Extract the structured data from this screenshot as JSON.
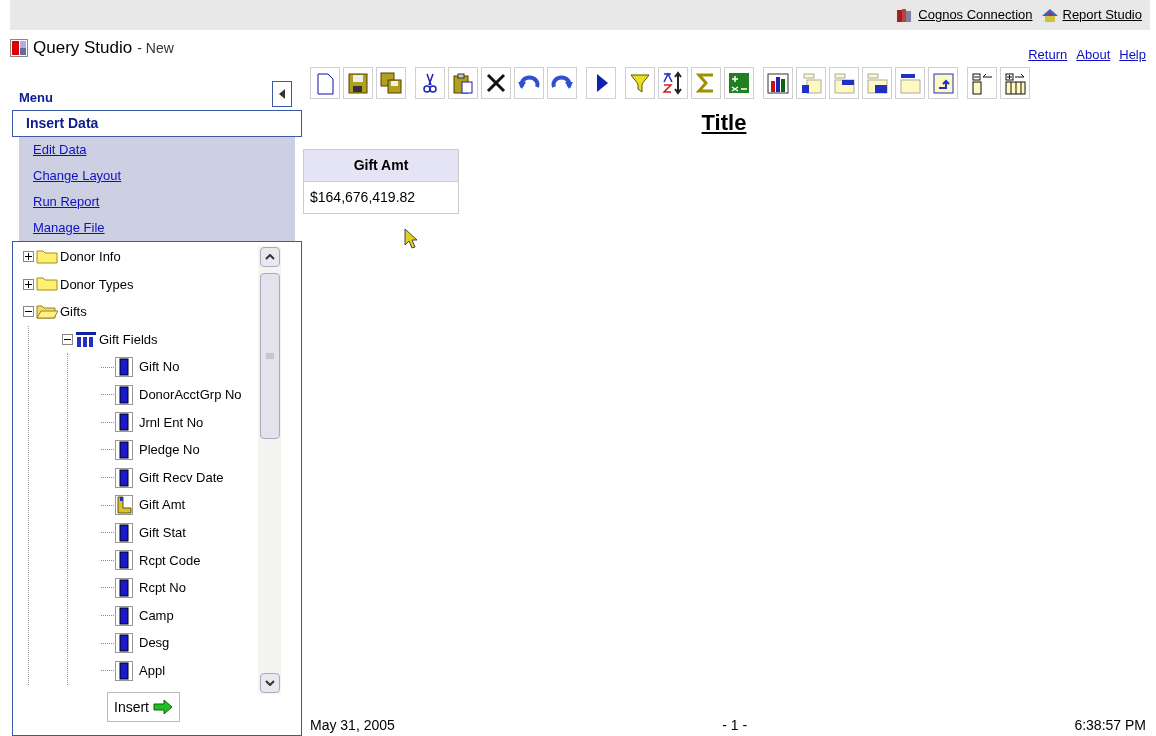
{
  "top_links": [
    {
      "kind": "connection",
      "label": "Cognos Connection"
    },
    {
      "kind": "studio",
      "label": "Report Studio"
    }
  ],
  "app": {
    "title": "Query Studio",
    "subtitle": "- New"
  },
  "header_links": [
    "Return",
    "About",
    "Help"
  ],
  "menu": {
    "title": "Menu",
    "items": [
      {
        "label": "Insert Data",
        "selected": true
      },
      {
        "label": "Edit Data",
        "selected": false
      },
      {
        "label": "Change Layout",
        "selected": false
      },
      {
        "label": "Run Report",
        "selected": false
      },
      {
        "label": "Manage File",
        "selected": false
      }
    ]
  },
  "tree": [
    {
      "label": "Donor Info",
      "kind": "folder",
      "expanded": false
    },
    {
      "label": "Donor Types",
      "kind": "folder",
      "expanded": false
    },
    {
      "label": "Gifts",
      "kind": "folder",
      "expanded": true,
      "children": [
        {
          "label": "Gift Fields",
          "kind": "table",
          "expanded": true,
          "children": [
            {
              "label": "Gift No",
              "kind": "attribute"
            },
            {
              "label": "DonorAcctGrp No",
              "kind": "attribute"
            },
            {
              "label": "Jrnl Ent No",
              "kind": "attribute"
            },
            {
              "label": "Pledge No",
              "kind": "attribute"
            },
            {
              "label": "Gift Recv Date",
              "kind": "attribute"
            },
            {
              "label": "Gift Amt",
              "kind": "measure"
            },
            {
              "label": "Gift Stat",
              "kind": "attribute"
            },
            {
              "label": "Rcpt Code",
              "kind": "attribute"
            },
            {
              "label": "Rcpt No",
              "kind": "attribute"
            },
            {
              "label": "Camp",
              "kind": "attribute"
            },
            {
              "label": "Desg",
              "kind": "attribute"
            },
            {
              "label": "Appl",
              "kind": "attribute"
            }
          ]
        }
      ]
    }
  ],
  "insert_button": "Insert",
  "toolbar": [
    {
      "tools": [
        {
          "kind": "new"
        },
        {
          "kind": "save"
        },
        {
          "kind": "save_as"
        }
      ]
    },
    {
      "tools": [
        {
          "kind": "cut"
        },
        {
          "kind": "paste"
        },
        {
          "kind": "delete"
        },
        {
          "kind": "undo"
        },
        {
          "kind": "redo"
        }
      ]
    },
    {
      "tools": [
        {
          "kind": "run"
        }
      ]
    },
    {
      "tools": [
        {
          "kind": "filter"
        },
        {
          "kind": "sort"
        },
        {
          "kind": "sum"
        },
        {
          "kind": "calculate"
        }
      ]
    },
    {
      "tools": [
        {
          "kind": "chart"
        },
        {
          "kind": "layout_a"
        },
        {
          "kind": "layout_b"
        },
        {
          "kind": "layout_c"
        },
        {
          "kind": "layout_d"
        },
        {
          "kind": "pivot"
        }
      ]
    },
    {
      "tools": [
        {
          "kind": "collapse"
        },
        {
          "kind": "expand"
        }
      ]
    }
  ],
  "report": {
    "title": "Title",
    "table": {
      "columns": [
        "Gift Amt"
      ],
      "rows": [
        [
          "$164,676,419.82"
        ]
      ]
    }
  },
  "footer": {
    "date": "May 31, 2005",
    "page": "- 1 -",
    "time": "6:38:57 PM"
  }
}
